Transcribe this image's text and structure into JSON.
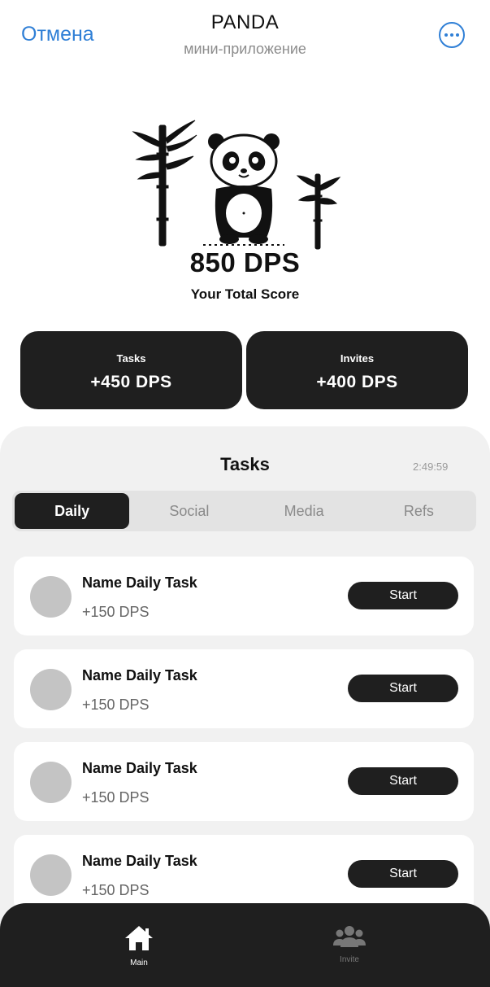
{
  "header": {
    "cancel_label": "Отмена",
    "title": "PANDA",
    "subtitle": "мини-приложение",
    "more_icon": "more-horizontal-icon"
  },
  "hero": {
    "illustration": "panda-with-bamboo",
    "score": "850 DPS",
    "score_label": "Your Total Score"
  },
  "stats": {
    "tasks": {
      "label": "Tasks",
      "value": "+450 DPS"
    },
    "invites": {
      "label": "Invites",
      "value": "+400 DPS"
    }
  },
  "tasks_panel": {
    "title": "Tasks",
    "timer": "2:49:59",
    "tabs": [
      {
        "label": "Daily",
        "active": true
      },
      {
        "label": "Social",
        "active": false
      },
      {
        "label": "Media",
        "active": false
      },
      {
        "label": "Refs",
        "active": false
      }
    ],
    "items": [
      {
        "name": "Name Daily Task",
        "reward": "+150 DPS",
        "button": "Start"
      },
      {
        "name": "Name Daily Task",
        "reward": "+150 DPS",
        "button": "Start"
      },
      {
        "name": "Name Daily Task",
        "reward": "+150 DPS",
        "button": "Start"
      },
      {
        "name": "Name Daily Task",
        "reward": "+150 DPS",
        "button": "Start"
      }
    ]
  },
  "bottom_nav": {
    "items": [
      {
        "label": "Main",
        "icon": "home-icon",
        "active": true
      },
      {
        "label": "Invite",
        "icon": "users-icon",
        "active": false
      }
    ]
  },
  "colors": {
    "accent_blue": "#2f7fd6",
    "dark": "#1f1f1f",
    "panel_bg": "#f1f1f1"
  }
}
